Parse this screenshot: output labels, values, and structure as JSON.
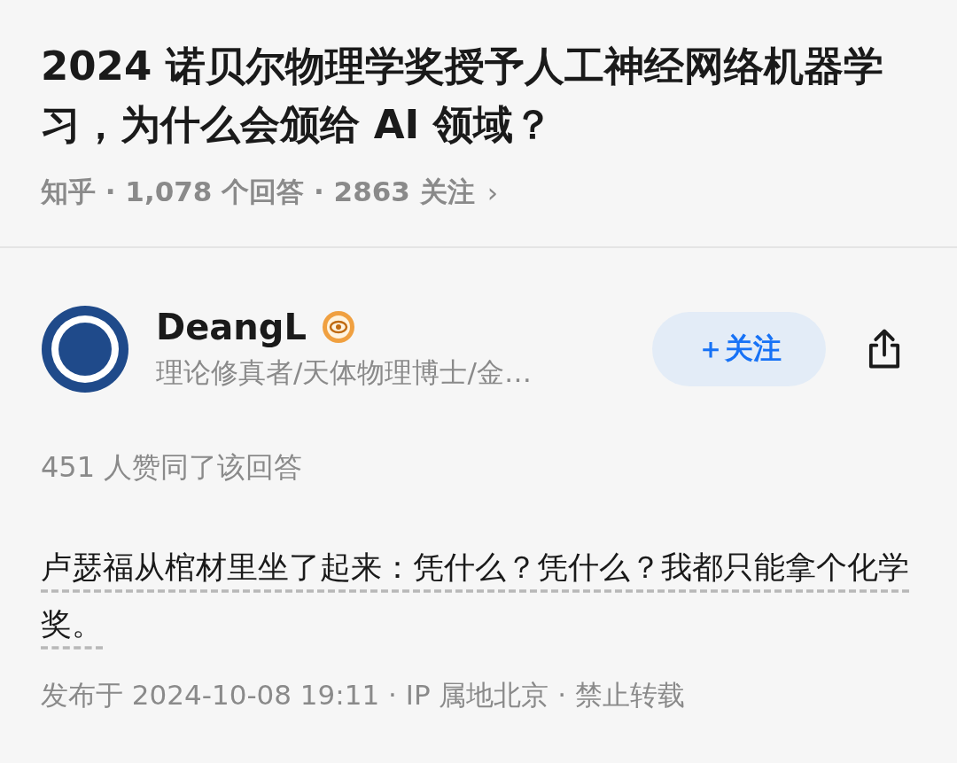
{
  "question": {
    "title": "2024 诺贝尔物理学奖授予人工神经网络机器学习，为什么会颁给 AI 领域？",
    "meta": "知乎 · 1,078 个回答 · 2863 关注",
    "chevron": "›"
  },
  "author": {
    "name": "DeangL",
    "bio": "理论修真者/天体物理博士/金…",
    "follow_label": "＋关注",
    "followed": false
  },
  "answer": {
    "upvotes": "451 人赞同了该回答",
    "text": "卢瑟福从棺材里坐了起来：凭什么？凭什么？我都只能拿个化学奖。",
    "footer": "发布于 2024-10-08 19:11 · IP 属地北京 · 禁止转载"
  }
}
